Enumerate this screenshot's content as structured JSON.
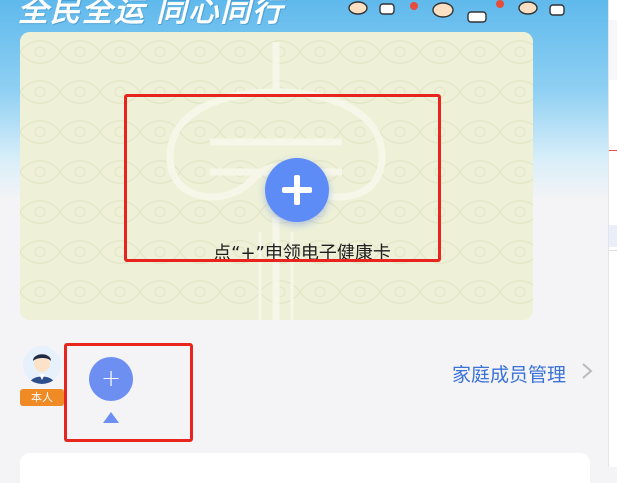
{
  "banner": {
    "title": "全民全运 同心同行",
    "icon": "runners-illustration"
  },
  "health_card": {
    "add_icon": "plus-icon",
    "prompt": "点“+”申领电子健康卡"
  },
  "member_bar": {
    "self_tag": "本人",
    "add_member_symbol": "+",
    "manage_link": "家庭成员管理",
    "manage_icon": "chevron-right-icon"
  },
  "colors": {
    "accent_blue": "#5e8cf7",
    "link_blue": "#3a72d8",
    "highlight_red": "#e8241f",
    "tag_orange": "#ef8a24",
    "card_bg": "#eef1d8"
  }
}
